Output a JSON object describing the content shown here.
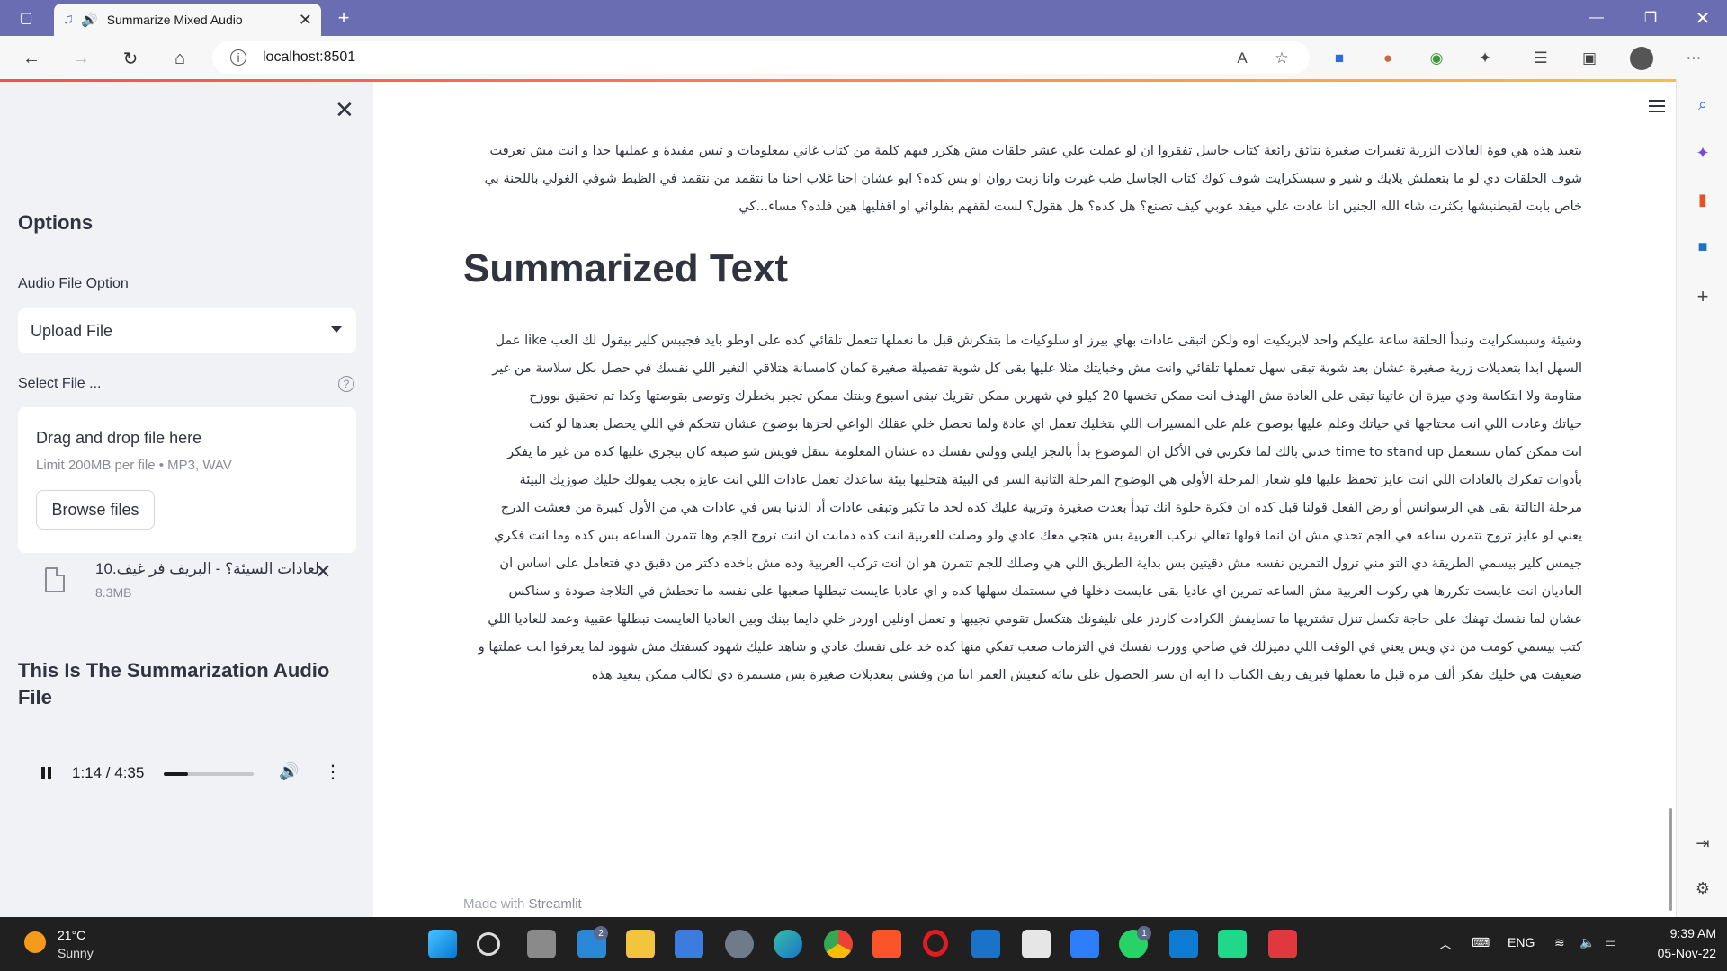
{
  "browser": {
    "tab_title": "Summarize Mixed Audio",
    "url": "localhost:8501"
  },
  "sidebar": {
    "options_heading": "Options",
    "audio_option_label": "Audio File Option",
    "audio_option_value": "Upload File",
    "select_file_label": "Select File ...",
    "help_glyph": "?",
    "dropzone_title": "Drag and drop file here",
    "dropzone_limit": "Limit 200MB per file • MP3, WAV",
    "browse_label": "Browse files",
    "file_name": "لعادات السيئة؟ - البريف فر غيف.10...",
    "file_size": "8.3MB",
    "summary_audio_heading": "This Is The Summarization Audio File",
    "player": {
      "time": "1:14 / 4:35",
      "progress": 0.27
    }
  },
  "main": {
    "transcript_lines": [
      "يتعيد هذه هي قوة العالات الزرية تغييرات صغيرة نتائق رائعة كتاب جاسل تفقروا ان لو عملت علي عشر حلقات مش هكرر فيهم كلمة من كتاب غاني بمعلومات و تبس مفيدة و عمليها جدا و انت مش تعرفت",
      "شوف الحلقات دي لو ما بتعملش يلايك و شير و سبسكرايت شوف كوك كتاب الجاسل طب غيرت وانا زبت روان او بس كده؟ ايو عشان احنا غلاب احنا ما نتقمد من نتقمد في الظبط شوفي الغولي باللحنة بي",
      "خاص بابت لقبطنيشها بكثرت شاء الله الجنين انا عادت علي ميقد عوبي كيف تصنع؟ هل كده؟ هل هقول؟ لست لقفهم بفلوائي او اقفليها هين فلده؟ مساء...كي"
    ],
    "summary_heading": "Summarized Text",
    "summary_lines": [
      "وشيئة وسبسكرايت ونبدأ الحلقة ساعة عليكم واحد لابريكيت اوه ولكن اتبقى عادات بهاي بيرز او سلوكيات ما بتفكرش قبل ما نعملها تتعمل تلقائي كده على اوطو بايد فجيبس كلير بيقول لك العب like عمل",
      "السهل ابدا بتعديلات زرية صغيرة عشان بعد شوية تبقى سهل تعملها تلقائي وانت مش وخبايتك مثلا عليها بقى كل شوية تفصيلة صغيرة كمان كامسانة هتلاقي التغير اللي نفسك في حصل بكل سلاسة من غير",
      "مقاومة ولا انتكاسة ودي ميزة ان عاتينا تبقى على العادة مش الهدف انت ممكن تخسها 20 كيلو في شهرين ممكن تقريك تبقى اسبوع وبنتك ممكن تجبر بخطرك وتوصى بقوصتها وكدا تم تحقيق بووزح",
      "حياتك وعادت اللي انت محتاجها في حياتك وعلم عليها بوضوح علم على المسيرات اللي بتخليك تعمل اي عادة ولما تحصل خلي عقلك الواعي لحزها بوضوح عشان تتحكم في اللي يحصل بعدها لو كنت",
      "انت ممكن كمان تستعمل time to stand up خدتي بالك لما فكرتي في الأكل ان الموضوع بدأ بالنجز ايلتي وولتي نفسك ده عشان المعلومة تتنقل فويش شو صبعه كان بيجري عليها كده من غير ما يفكر",
      "بأدوات تفكرك بالعادات اللي انت عايز تحفظ عليها فلو شعار المرحلة الأولى هي الوضوح المرحلة التانية السر في البيئة هتخليها بيئة ساعدك تعمل عادات اللي انت عايزه بجب يقولك خليك صوزيك البيئة",
      "مرحلة التالتة بقى هي الرسوانس أو رض الفعل قولنا قبل كده ان فكرة حلوة انك تبدأ بعدت صغيرة وتربية عليك كده لحد ما تكبر وتبقى عادات أد الدنيا بس في عادات هي من الأول كبيرة من فعشت الدرج",
      "يعني لو عايز تروح تتمرن ساعه في الجم تحدي مش ان انما قولها تعالي نركب العربية بس هتجي معك عادي ولو وصلت للعربية انت كده دمانت ان انت تروح الجم وها تتمرن الساعه بس كده وما انت فكري",
      "جيمس كلير بيسمي الطريقة دي التو مني ترول التمرين نفسه مش دقيتين بس بداية الطريق اللي هي وصلك للجم تتمرن هو ان انت تركب العربية وده مش باخده دكتر من دقيق دي فتعامل على اساس ان",
      "العاديان انت عايست تكررها هي ركوب العربية مش الساعه تمرين اي عاديا بقى عايست دخلها في سستمك سهلها كده و اي عاديا عايست تبطلها صعبها على نفسه ما تحطش في التلاجة صودة و سناكس",
      "عشان لما نفسك تهفك على حاجة تكسل تنزل تشتريها ما تسايفش الكرادت كاردز على تليفونك هتكسل تقومي تجيبها و تعمل اونلين اوردر خلي دايما بينك وبين العاديا العايست تبطلها عقبية وعمد للعاديا اللي",
      "كتب بيسمي كومت من دي ويس يعني في الوقت اللي دميزلك في صاحي وورت نفسك في التزمات صعب تفكي منها كده خد على نفسك عادي و شاهد عليك شهود كسفتك مش شهود لما يعرفوا انت عملتها و",
      "ضعيفت هي خليك تفكر ألف مره قبل ما تعملها فبريف ريف الكتاب دا ايه ان نسر الحصول على نتائه كتعيش العمر اننا من وفشي بتعديلات صغيرة بس مستمرة دي لكالب ممكن يتعيد هذه"
    ],
    "made_with_prefix": "Made with ",
    "made_with_brand": "Streamlit"
  },
  "taskbar": {
    "weather_temp": "21°C",
    "weather_desc": "Sunny",
    "mail_badge": "2",
    "whatsapp_badge": "1",
    "language": "ENG",
    "time": "9:39 AM",
    "date": "05-Nov-22"
  }
}
